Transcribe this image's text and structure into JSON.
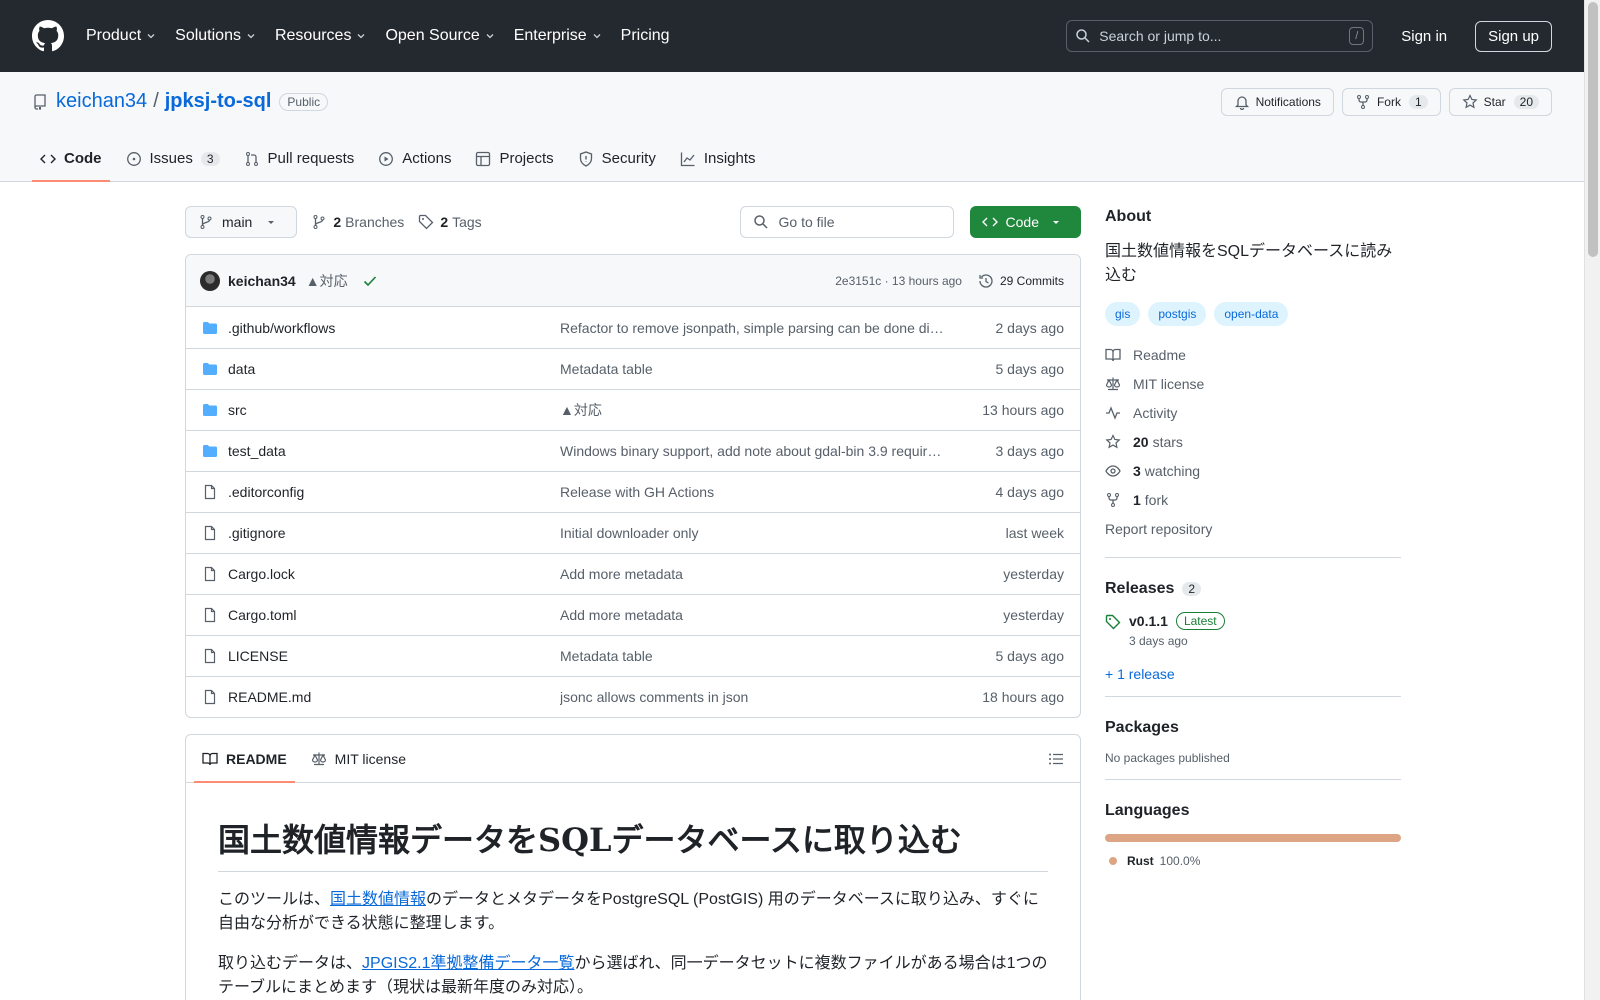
{
  "header": {
    "nav": [
      {
        "label": "Product",
        "dropdown": true
      },
      {
        "label": "Solutions",
        "dropdown": true
      },
      {
        "label": "Resources",
        "dropdown": true
      },
      {
        "label": "Open Source",
        "dropdown": true
      },
      {
        "label": "Enterprise",
        "dropdown": true
      },
      {
        "label": "Pricing",
        "dropdown": false
      }
    ],
    "search_placeholder": "Search or jump to...",
    "search_shortcut": "/",
    "sign_in": "Sign in",
    "sign_up": "Sign up"
  },
  "repo": {
    "owner": "keichan34",
    "separator": "/",
    "name": "jpksj-to-sql",
    "visibility": "Public",
    "notifications_label": "Notifications",
    "fork_label": "Fork",
    "fork_count": "1",
    "star_label": "Star",
    "star_count": "20",
    "tabs": [
      {
        "label": "Code",
        "count": "",
        "active": true
      },
      {
        "label": "Issues",
        "count": "3",
        "active": false
      },
      {
        "label": "Pull requests",
        "count": "",
        "active": false
      },
      {
        "label": "Actions",
        "count": "",
        "active": false
      },
      {
        "label": "Projects",
        "count": "",
        "active": false
      },
      {
        "label": "Security",
        "count": "",
        "active": false
      },
      {
        "label": "Insights",
        "count": "",
        "active": false
      }
    ]
  },
  "toolbar": {
    "branch": "main",
    "branches_count": "2",
    "branches_label": "Branches",
    "tags_count": "2",
    "tags_label": "Tags",
    "goto_placeholder": "Go to file",
    "code_label": "Code"
  },
  "latest_commit": {
    "author": "keichan34",
    "message": "▲対応",
    "hash_time": "2e3151c · 13 hours ago",
    "commits_label": "29 Commits"
  },
  "files": [
    {
      "name": ".github/workflows",
      "type": "dir",
      "message": "Refactor to remove jsonpath, simple parsing can be done di…",
      "date": "2 days ago"
    },
    {
      "name": "data",
      "type": "dir",
      "message": "Metadata table",
      "date": "5 days ago"
    },
    {
      "name": "src",
      "type": "dir",
      "message": "▲対応",
      "date": "13 hours ago"
    },
    {
      "name": "test_data",
      "type": "dir",
      "message": "Windows binary support, add note about gdal-bin 3.9 requir…",
      "date": "3 days ago"
    },
    {
      "name": ".editorconfig",
      "type": "file",
      "message": "Release with GH Actions",
      "date": "4 days ago"
    },
    {
      "name": ".gitignore",
      "type": "file",
      "message": "Initial downloader only",
      "date": "last week"
    },
    {
      "name": "Cargo.lock",
      "type": "file",
      "message": "Add more metadata",
      "date": "yesterday"
    },
    {
      "name": "Cargo.toml",
      "type": "file",
      "message": "Add more metadata",
      "date": "yesterday"
    },
    {
      "name": "LICENSE",
      "type": "file",
      "message": "Metadata table",
      "date": "5 days ago"
    },
    {
      "name": "README.md",
      "type": "file",
      "message": "jsonc allows comments in json",
      "date": "18 hours ago"
    }
  ],
  "readme": {
    "tab_readme": "README",
    "tab_license": "MIT license",
    "h1": "国土数値情報データをSQLデータベースに取り込む",
    "p1_a": "このツールは、",
    "p1_link": "国土数値情報",
    "p1_b": "のデータとメタデータをPostgreSQL (PostGIS) 用のデータベースに取り込み、すぐに自由な分析ができる状態に整理します。",
    "p2_a": "取り込むデータは、",
    "p2_link": "JPGIS2.1準拠整備データ一覧",
    "p2_b": "から選ばれ、同一データセットに複数ファイルがある場合は1つのテーブルにまとめます（現状は最新年度のみ対応）。"
  },
  "sidebar": {
    "about_title": "About",
    "description": "国土数値情報をSQLデータベースに読み込む",
    "topics": [
      "gis",
      "postgis",
      "open-data"
    ],
    "readme_link": "Readme",
    "license_link": "MIT license",
    "activity_link": "Activity",
    "stars_count": "20",
    "stars_label": "stars",
    "watching_count": "3",
    "watching_label": "watching",
    "forks_count": "1",
    "forks_label": "fork",
    "report": "Report repository",
    "releases_title": "Releases",
    "releases_count": "2",
    "release_version": "v0.1.1",
    "release_badge": "Latest",
    "release_date": "3 days ago",
    "more_releases": "+ 1 release",
    "packages_title": "Packages",
    "packages_text": "No packages published",
    "languages_title": "Languages",
    "language_name": "Rust",
    "language_percent": "100.0%",
    "language_color": "#dea584"
  }
}
